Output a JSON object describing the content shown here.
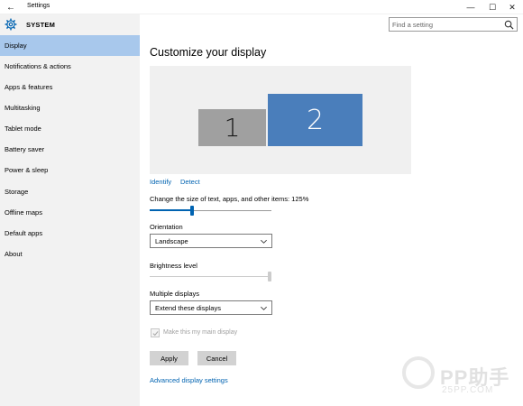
{
  "window": {
    "title": "Settings",
    "back_glyph": "←",
    "minimize_glyph": "—",
    "maximize_glyph": "☐",
    "close_glyph": "✕"
  },
  "sidebar": {
    "header_icon": "gear-icon",
    "header": "SYSTEM",
    "items": [
      {
        "label": "Display",
        "active": true
      },
      {
        "label": "Notifications & actions",
        "active": false
      },
      {
        "label": "Apps & features",
        "active": false
      },
      {
        "label": "Multitasking",
        "active": false
      },
      {
        "label": "Tablet mode",
        "active": false
      },
      {
        "label": "Battery saver",
        "active": false
      },
      {
        "label": "Power & sleep",
        "active": false
      },
      {
        "label": "Storage",
        "active": false
      },
      {
        "label": "Offline maps",
        "active": false
      },
      {
        "label": "Default apps",
        "active": false
      },
      {
        "label": "About",
        "active": false
      }
    ]
  },
  "search": {
    "placeholder": "Find a setting",
    "icon": "search-icon"
  },
  "main": {
    "title": "Customize your display",
    "monitors": [
      {
        "label": "1",
        "color": "#a0a0a0"
      },
      {
        "label": "2",
        "color": "#4a7ebb"
      }
    ],
    "identify": "Identify",
    "detect": "Detect",
    "scale_label": "Change the size of text, apps, and other items: 125%",
    "scale_slider_fraction": 0.34,
    "orientation_label": "Orientation",
    "orientation_value": "Landscape",
    "brightness_label": "Brightness level",
    "brightness_fraction": 1.0,
    "multiple_displays_label": "Multiple displays",
    "multiple_displays_value": "Extend these displays",
    "main_display_checkbox": "Make this my main display",
    "main_display_checked": true,
    "main_display_disabled": true,
    "apply": "Apply",
    "cancel": "Cancel",
    "advanced_link": "Advanced display settings"
  },
  "watermark": {
    "brand": "PP助手",
    "sub": "25PP.COM"
  },
  "colors": {
    "accent": "#0063b1",
    "active_nav": "#a8c8ec",
    "sidebar_bg": "#f2f2f2",
    "monitor_2": "#4a7ebb"
  }
}
